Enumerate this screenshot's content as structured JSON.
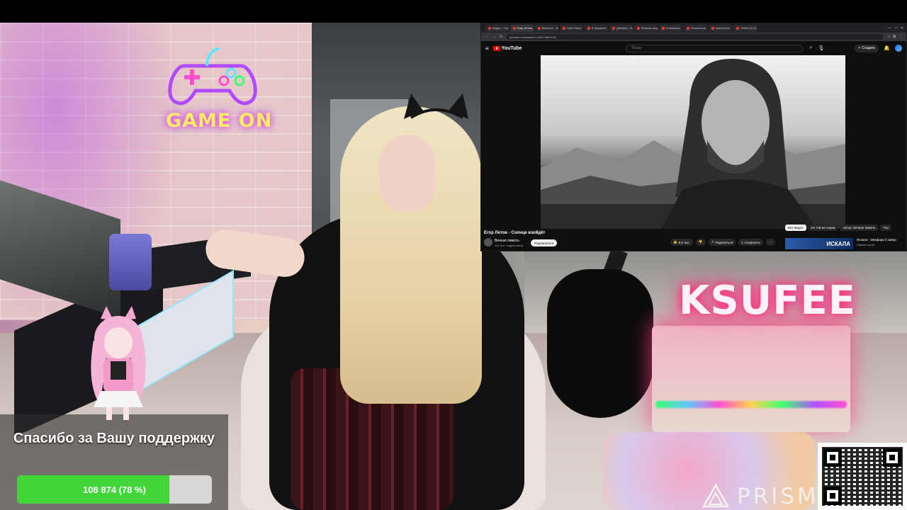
{
  "scene": {
    "neon_sign": "GAME ON",
    "brand_sign": "KSUFEE",
    "watermark": "PRISM"
  },
  "donation": {
    "message": "Спасибо за Вашу поддержку",
    "progress_label": "108 874 (78 %)",
    "progress_fraction": 0.78,
    "accent_color": "#43d63a"
  },
  "browser": {
    "tabs": [
      "Кадры - YouTube",
      "Егор Летов - С...",
      "Behance - Wh...",
      "Chat+Nano",
      "В формате",
      "Дневник - Кон",
      "Важные видео",
      "Ксабарова",
      "Записаться",
      "ksenia-kwo",
      "Tribes (3) 4/2"
    ],
    "url": "youtube.com/watch?v=l9IC-MbKOYA"
  },
  "youtube": {
    "logo_text": "YouTube",
    "search_placeholder": "Поиск",
    "create_label": "Создать",
    "video_title": "Егор Летов - Солнце взойдёт",
    "channel_name": "Вечная память",
    "subscribers": "113 тыс. подписчиков",
    "subscribe_label": "Подписаться",
    "like_count": "6,8 тыс.",
    "share_label": "Поделиться",
    "save_label": "Сохранить",
    "chips": [
      "Все видео",
      "Из той же серии",
      "Автор: Вечная память",
      "Пох"
    ],
    "reco_thumb_text": "ИСКАЛА",
    "reco_title": "Искала - Земфира // кавер",
    "reco_channel": "Ларкин песни",
    "brand_color": "#ff0000"
  }
}
